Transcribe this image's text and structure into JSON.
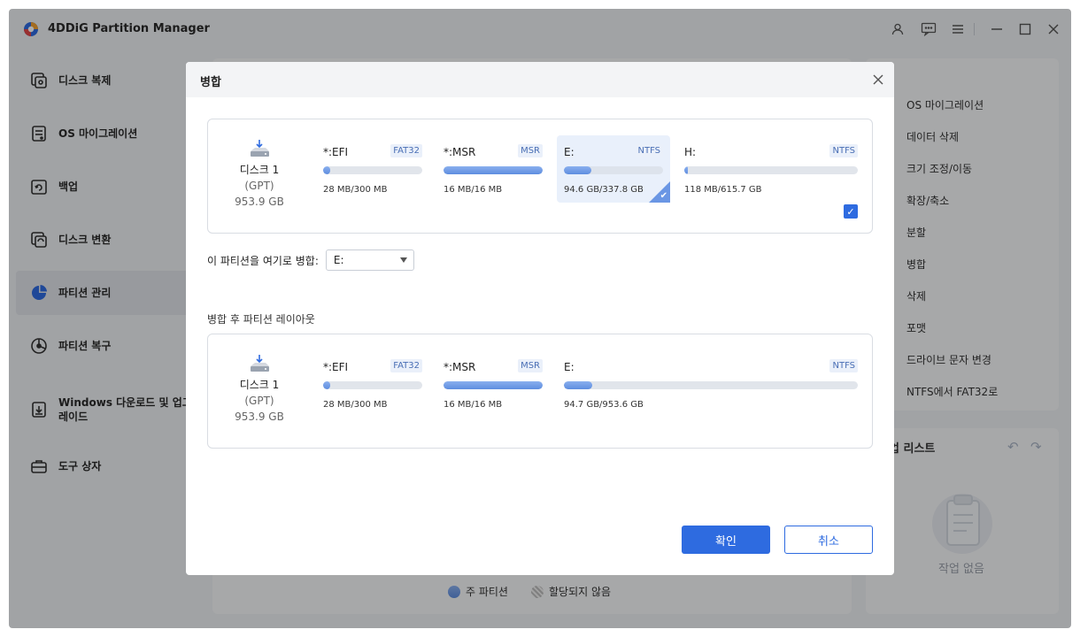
{
  "app": {
    "title": "4DDiG Partition Manager"
  },
  "sidebar": {
    "items": [
      {
        "label": "디스크 복제"
      },
      {
        "label": "OS 마이그레이션"
      },
      {
        "label": "백업"
      },
      {
        "label": "디스크 변환"
      },
      {
        "label": "파티션 관리"
      },
      {
        "label": "파티션 복구"
      },
      {
        "label": "Windows 다운로드 및 업그레이드"
      },
      {
        "label": "도구 상자"
      }
    ],
    "active_index": 4
  },
  "right_panel": {
    "items": [
      {
        "label": "OS 마이그레이션"
      },
      {
        "label": "데이터 삭제"
      },
      {
        "label": "크기 조정/이동"
      },
      {
        "label": "확장/축소"
      },
      {
        "label": "분할"
      },
      {
        "label": "병합"
      },
      {
        "label": "삭제"
      },
      {
        "label": "포맷"
      },
      {
        "label": "드라이브 문자 변경"
      },
      {
        "label": "NTFS에서 FAT32로"
      }
    ]
  },
  "ops_panel": {
    "title": "작업 리스트",
    "title_visible": "업 리스트",
    "empty_text": "작업 없음"
  },
  "legend": {
    "primary": "주 파티션",
    "unallocated": "할당되지 않음"
  },
  "modal": {
    "title": "병합",
    "merge_label": "이 파티션을 여기로 병합:",
    "merge_target": "E:",
    "layout_label": "병합 후 파티션 레이아웃",
    "confirm_label": "확인",
    "cancel_label": "취소",
    "disk_before": {
      "name": "디스크 1",
      "type": "(GPT)",
      "size": "953.9 GB",
      "partitions": [
        {
          "name": "*:EFI",
          "fs": "FAT32",
          "usage": "28 MB/300 MB",
          "fill": 0.07
        },
        {
          "name": "*:MSR",
          "fs": "MSR",
          "usage": "16 MB/16 MB",
          "fill": 1.0
        },
        {
          "name": "E:",
          "fs": "NTFS",
          "usage": "94.6 GB/337.8 GB",
          "fill": 0.28,
          "selected": true
        },
        {
          "name": "H:",
          "fs": "NTFS",
          "usage": "118 MB/615.7 GB",
          "fill": 0.02,
          "checked": true
        }
      ]
    },
    "disk_after": {
      "name": "디스크 1",
      "type": "(GPT)",
      "size": "953.9 GB",
      "partitions": [
        {
          "name": "*:EFI",
          "fs": "FAT32",
          "usage": "28 MB/300 MB",
          "fill": 0.07
        },
        {
          "name": "*:MSR",
          "fs": "MSR",
          "usage": "16 MB/16 MB",
          "fill": 1.0
        },
        {
          "name": "E:",
          "fs": "NTFS",
          "usage": "94.7 GB/953.6 GB",
          "fill": 0.095
        }
      ]
    }
  },
  "colors": {
    "accent": "#2e6be0",
    "bar_fill": "#6a96e4"
  }
}
